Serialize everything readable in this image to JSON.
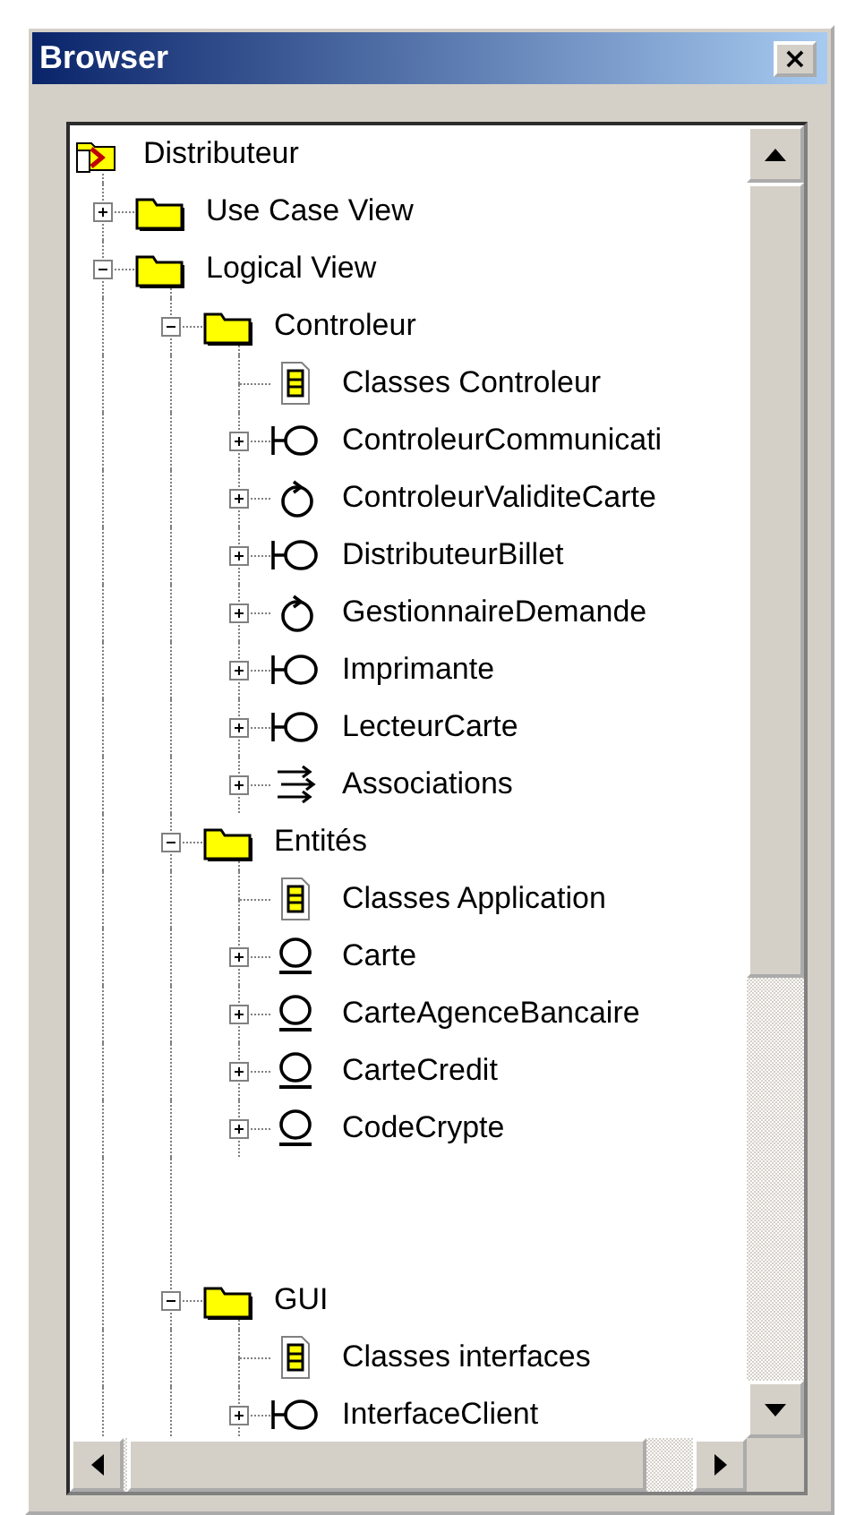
{
  "window": {
    "title": "Browser",
    "close_label": "×"
  },
  "tree": {
    "label": "Distributeur",
    "kind": "model",
    "children": [
      {
        "label": "Use Case View",
        "kind": "package",
        "expanded": false
      },
      {
        "label": "Logical View",
        "kind": "package",
        "expanded": true,
        "children": [
          {
            "label": "Controleur",
            "kind": "package",
            "expanded": true,
            "children": [
              {
                "label": "Classes Controleur",
                "kind": "diagram"
              },
              {
                "label": "ControleurCommunicati",
                "kind": "boundary",
                "expanded": false
              },
              {
                "label": "ControleurValiditeCarte",
                "kind": "control",
                "expanded": false
              },
              {
                "label": "DistributeurBillet",
                "kind": "boundary",
                "expanded": false
              },
              {
                "label": "GestionnaireDemande",
                "kind": "control",
                "expanded": false
              },
              {
                "label": "Imprimante",
                "kind": "boundary",
                "expanded": false
              },
              {
                "label": "LecteurCarte",
                "kind": "boundary",
                "expanded": false
              },
              {
                "label": "Associations",
                "kind": "associations",
                "expanded": false
              }
            ]
          },
          {
            "label": "Entités",
            "kind": "package",
            "expanded": true,
            "children": [
              {
                "label": "Classes Application",
                "kind": "diagram"
              },
              {
                "label": "Carte",
                "kind": "entity",
                "expanded": false
              },
              {
                "label": "CarteAgenceBancaire",
                "kind": "entity",
                "expanded": false
              },
              {
                "label": "CarteCredit",
                "kind": "entity",
                "expanded": false
              },
              {
                "label": "CodeCrypte",
                "kind": "entity",
                "expanded": false
              }
            ]
          },
          {
            "label": "GUI",
            "kind": "package",
            "expanded": true,
            "gap_before": true,
            "children": [
              {
                "label": "Classes interfaces",
                "kind": "diagram"
              },
              {
                "label": "InterfaceClient",
                "kind": "boundary",
                "expanded": false
              }
            ]
          }
        ]
      }
    ]
  }
}
